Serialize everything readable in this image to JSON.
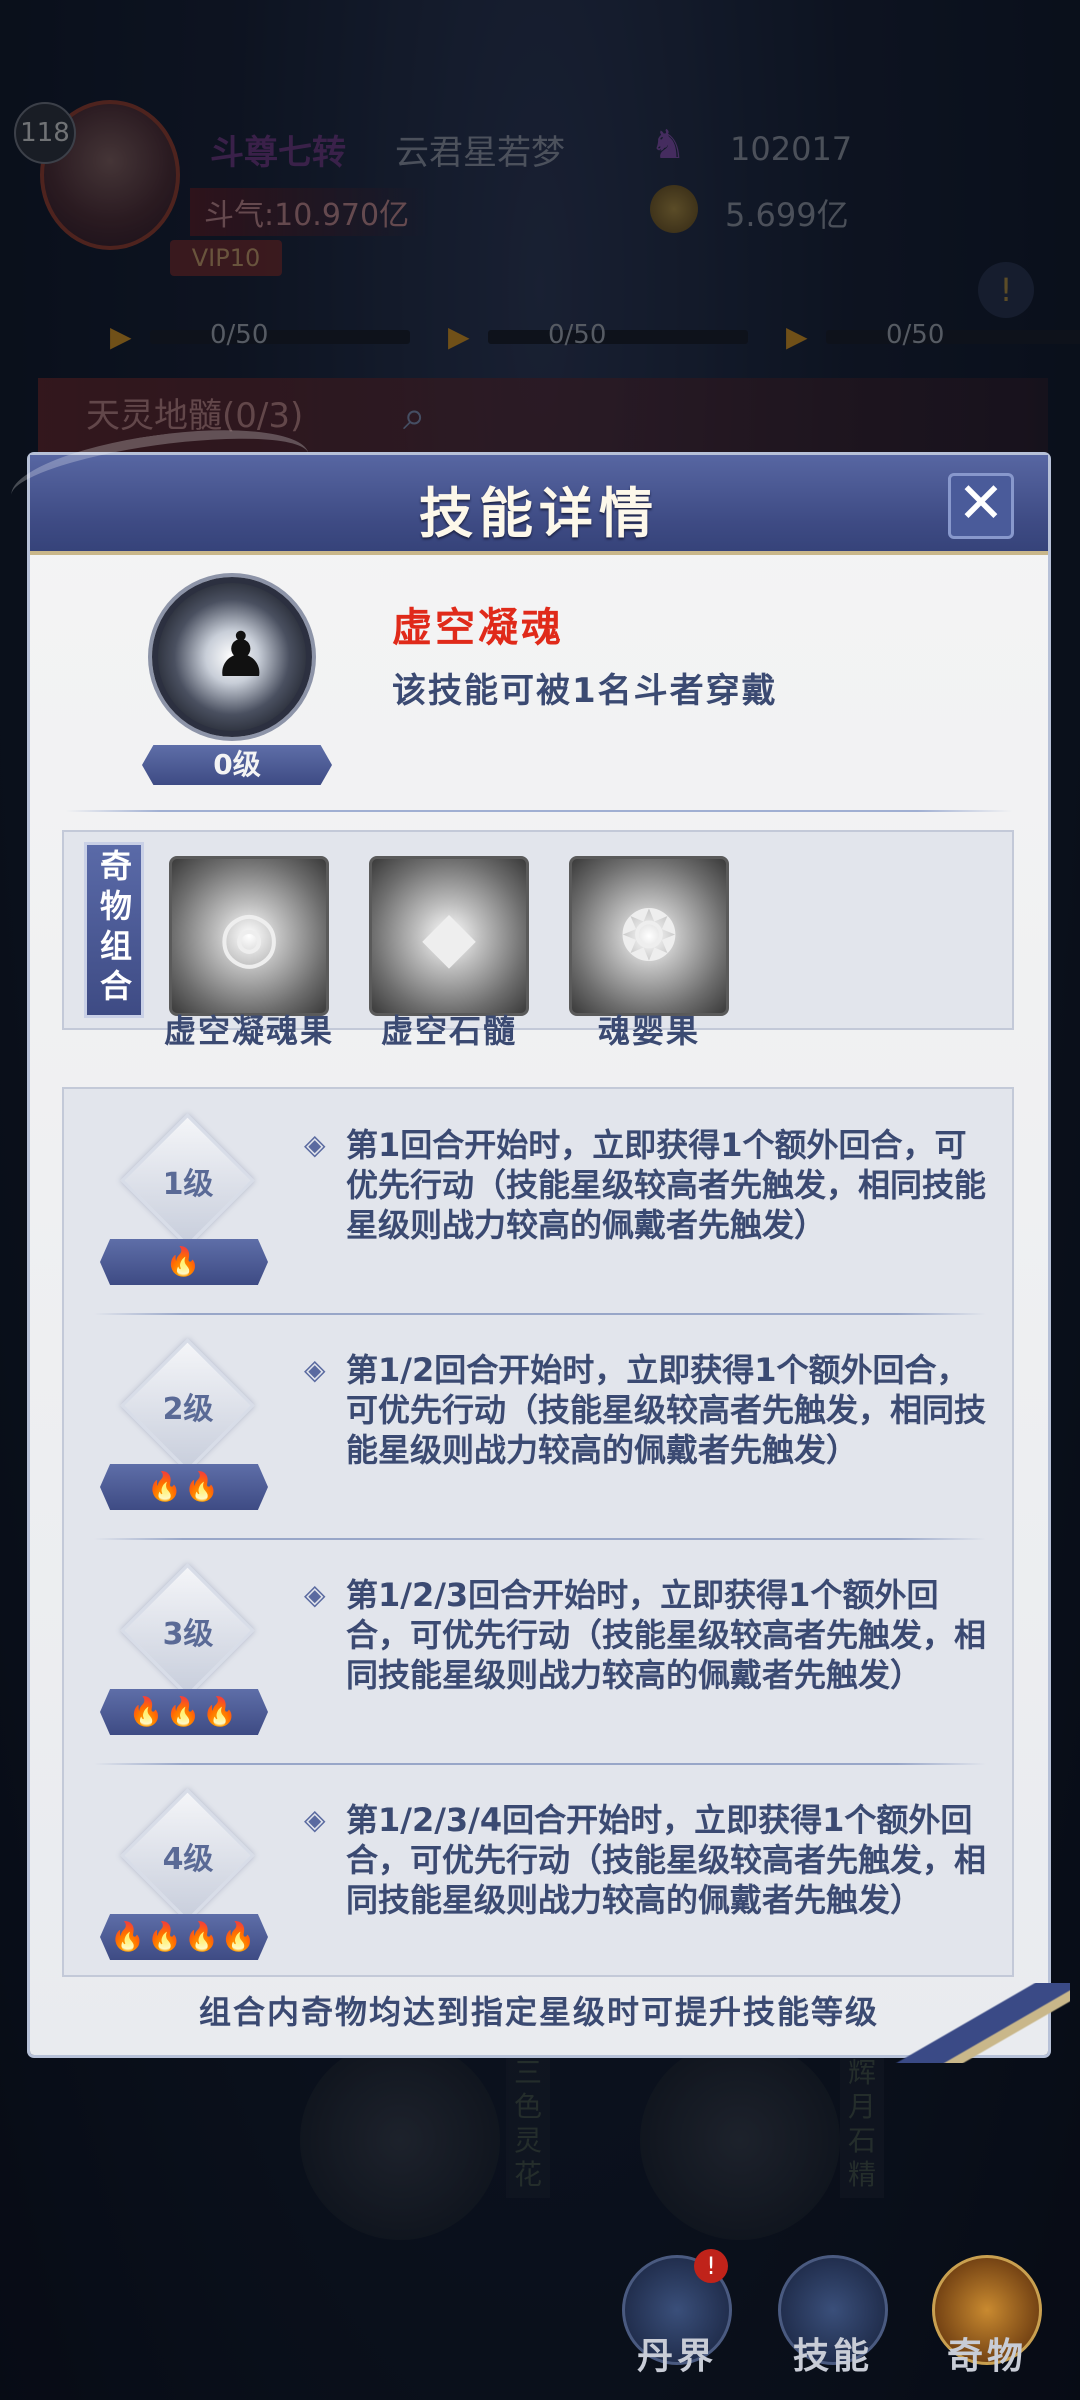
{
  "background": {
    "player_level": "118",
    "rank_title": "斗尊七转",
    "player_name": "云君星若梦",
    "power_label": "斗气:10.970亿",
    "vip": "VIP10",
    "resource1": "102017",
    "resource2": "5.699亿",
    "progress": [
      "0/50",
      "0/50",
      "0/50"
    ],
    "search_label": "天灵地髓(0/3)",
    "bottom_items": [
      "三色灵花",
      "辉月石精"
    ],
    "nav": [
      {
        "label": "丹界",
        "badge": "!"
      },
      {
        "label": "技能"
      },
      {
        "label": "奇物"
      }
    ]
  },
  "modal": {
    "title": "技能详情",
    "close": "✕",
    "skill": {
      "name": "虚空凝魂",
      "desc": "该技能可被1名斗者穿戴",
      "level": "0级"
    },
    "combo": {
      "tag": "奇物组合",
      "items": [
        {
          "name": "虚空凝魂果",
          "icon": "swirl-icon"
        },
        {
          "name": "虚空石髓",
          "icon": "crystal-icon"
        },
        {
          "name": "魂婴果",
          "icon": "fruit-icon"
        }
      ]
    },
    "levels": [
      {
        "level": "1级",
        "flames": "🔥",
        "text": "第1回合开始时，立即获得1个额外回合，可优先行动（技能星级较高者先触发，相同技能星级则战力较高的佩戴者先触发）"
      },
      {
        "level": "2级",
        "flames": "🔥🔥",
        "text": "第1/2回合开始时，立即获得1个额外回合，可优先行动（技能星级较高者先触发，相同技能星级则战力较高的佩戴者先触发）"
      },
      {
        "level": "3级",
        "flames": "🔥🔥🔥",
        "text": "第1/2/3回合开始时，立即获得1个额外回合，可优先行动（技能星级较高者先触发，相同技能星级则战力较高的佩戴者先触发）"
      },
      {
        "level": "4级",
        "flames": "🔥🔥🔥🔥",
        "text": "第1/2/3/4回合开始时，立即获得1个额外回合，可优先行动（技能星级较高者先触发，相同技能星级则战力较高的佩戴者先触发）"
      }
    ],
    "footer": "组合内奇物均达到指定星级时可提升技能等级"
  }
}
